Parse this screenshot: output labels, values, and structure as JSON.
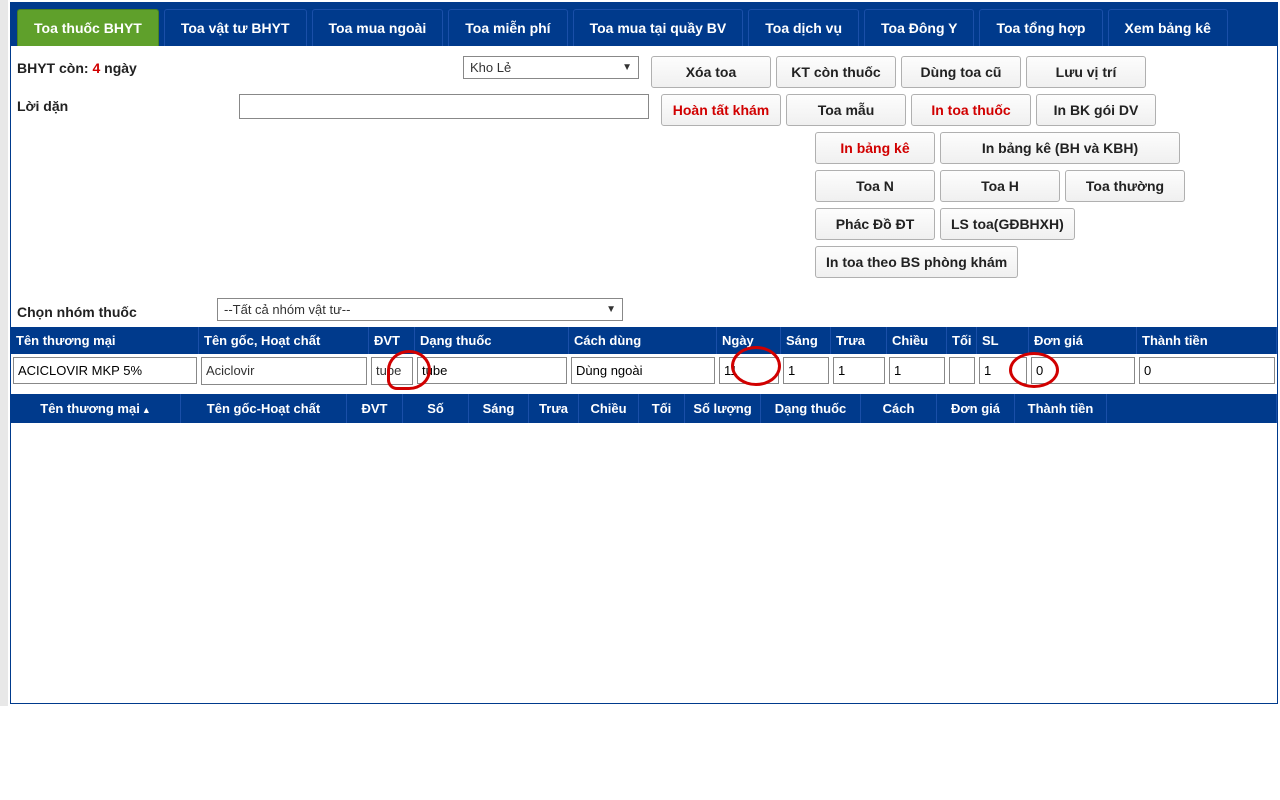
{
  "tabs": [
    {
      "label": "Toa thuốc BHYT",
      "active": true
    },
    {
      "label": "Toa vật tư BHYT"
    },
    {
      "label": "Toa mua ngoài"
    },
    {
      "label": "Toa miễn phí"
    },
    {
      "label": "Toa mua tại quầy BV"
    },
    {
      "label": "Toa dịch vụ"
    },
    {
      "label": "Toa Đông Y"
    },
    {
      "label": "Toa tổng hợp"
    },
    {
      "label": "Xem bảng kê"
    }
  ],
  "bhyt": {
    "label_prefix": "BHYT còn: ",
    "value": "4",
    "label_suffix": " ngày"
  },
  "kho_select": "Kho Lẻ",
  "loi_dan_label": "Lời dặn",
  "loi_dan_value": "",
  "buttons": {
    "row1": [
      "Xóa toa",
      "KT còn thuốc",
      "Dùng toa cũ",
      "Lưu vị trí"
    ],
    "row2": [
      {
        "label": "Hoàn tất khám",
        "red": true
      },
      {
        "label": "Toa mẫu"
      },
      {
        "label": "In toa thuốc",
        "red": true
      },
      {
        "label": "In BK gói DV"
      }
    ],
    "row3": [
      {
        "label": "In bảng kê",
        "red": true
      },
      {
        "label": "In bảng kê (BH và KBH)",
        "wide": true
      }
    ],
    "row4": [
      "Toa N",
      "Toa H",
      "Toa thường"
    ],
    "row5": [
      "Phác Đồ ĐT",
      "LS toa(GĐBHXH)"
    ],
    "row6": [
      "In toa theo BS phòng khám"
    ]
  },
  "group_label": "Chọn nhóm thuốc",
  "group_select": "--Tất cả nhóm vật tư--",
  "entry_headers": {
    "ten_tm": "Tên thương mại",
    "ten_goc": "Tên gốc, Hoạt chất",
    "dvt": "ĐVT",
    "dang": "Dạng thuốc",
    "cach": "Cách dùng",
    "ngay": "Ngày",
    "sang": "Sáng",
    "trua": "Trưa",
    "chieu": "Chiều",
    "toi": "Tối",
    "sl": "SL",
    "dongia": "Đơn giá",
    "thanhtien": "Thành tiền"
  },
  "entry": {
    "ten_tm": "ACICLOVIR MKP 5%",
    "ten_goc": "Aciclovir",
    "dvt": "tube",
    "dang": "tube",
    "cach": "Dùng ngoài",
    "ngay": "11",
    "sang": "1",
    "trua": "1",
    "chieu": "1",
    "toi": "",
    "sl": "1",
    "dongia": "0",
    "thanhtien": "0"
  },
  "grid_headers": {
    "ten_tm": "Tên thương mại",
    "ten_goc": "Tên gốc-Hoạt chất",
    "dvt": "ĐVT",
    "so": "Số",
    "sang": "Sáng",
    "trua": "Trưa",
    "chieu": "Chiều",
    "toi": "Tối",
    "sl": "Số lượng",
    "dang": "Dạng thuốc",
    "cach": "Cách",
    "dongia": "Đơn giá",
    "thanhtien": "Thành tiền"
  }
}
